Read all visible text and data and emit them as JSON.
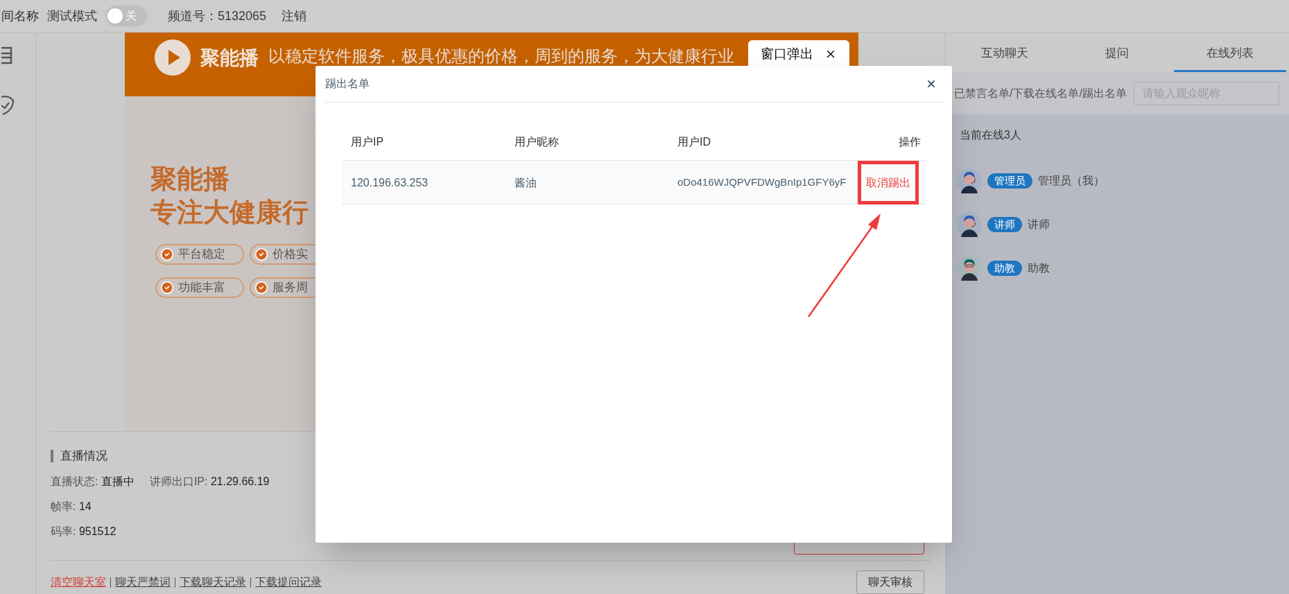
{
  "top_bar": {
    "room_name": "间名称",
    "test_mode": {
      "label": "测试模式",
      "on": false,
      "state_text": "关"
    },
    "channel": "频道号：5132065",
    "logout": "注销"
  },
  "side_rail": [
    {
      "kind": "notice"
    },
    {
      "kind": "checkin"
    }
  ],
  "banner": {
    "brand": "聚能播",
    "slogan": "以稳定软件服务，极具优惠的价格，周到的服务，为大健康行业",
    "headline": [
      "聚能播",
      "专注大健康行"
    ],
    "features": [
      "平台稳定",
      "价格实",
      "功能丰富",
      "服务周"
    ]
  },
  "live_status": {
    "title": "直播情况",
    "rows": [
      [
        {
          "label": "直播状态:",
          "value": "直播中"
        },
        {
          "label": "讲师出口IP:",
          "value": "21.29.66.19"
        }
      ],
      [
        {
          "label": "帧率:",
          "value": "14"
        }
      ],
      [
        {
          "label": "码率:",
          "value": "951512"
        }
      ]
    ]
  },
  "bottom_links": [
    {
      "label": "清空聊天室",
      "danger": true
    },
    {
      "label": "聊天严禁词",
      "danger": false
    },
    {
      "label": "下载聊天记录",
      "danger": false
    },
    {
      "label": "下载提问记录",
      "danger": false
    }
  ],
  "review_button": "聊天审核",
  "right_panel": {
    "tabs": [
      {
        "label": "互动聊天",
        "selected": false
      },
      {
        "label": "提问",
        "selected": false
      },
      {
        "label": "在线列表",
        "selected": true
      }
    ],
    "filter_links": "已禁言名单/下载在线名单/踢出名单",
    "search": {
      "placeholder": "请输入观众昵称"
    },
    "online_count": "当前在线3人",
    "users": [
      {
        "role": "管理员",
        "name": "管理员（我）",
        "kind": "headset"
      },
      {
        "role": "讲师",
        "name": "讲师",
        "kind": "headset"
      },
      {
        "role": "助教",
        "name": "助教",
        "kind": "glasses"
      }
    ]
  },
  "popup_tab": {
    "label": "窗口弹出"
  },
  "modal": {
    "title": "踢出名单",
    "columns": [
      "用户IP",
      "用户昵称",
      "用户ID",
      "操作"
    ],
    "rows": [
      {
        "ip": "120.196.63.253",
        "nickname": "酱油",
        "user_id": "oDo416WJQPVFDWgBnIp1GFY6yF",
        "action": "取消踢出",
        "highlighted": true
      }
    ]
  }
}
